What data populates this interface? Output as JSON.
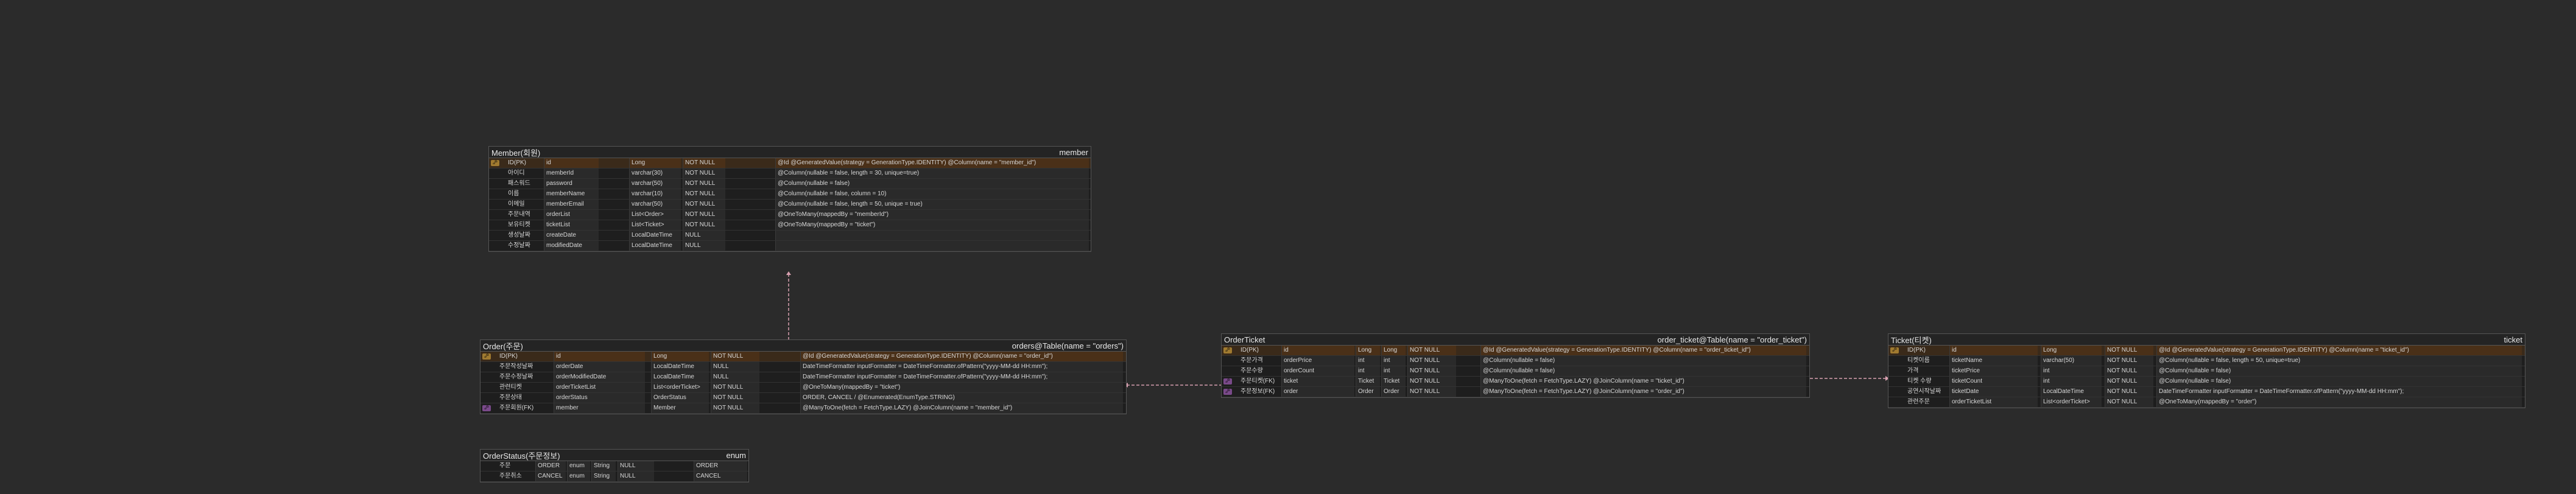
{
  "member": {
    "title": "Member(회원)",
    "table": "member",
    "rows": [
      {
        "badge": "pk",
        "logical": "ID(PK)",
        "physical": "id",
        "type": "Long",
        "null": "NOT NULL",
        "anno": "@Id @GeneratedValue(strategy = GenerationType.IDENTITY) @Column(name = \"member_id\")"
      },
      {
        "badge": "",
        "logical": "아이디",
        "physical": "memberId",
        "type": "varchar(30)",
        "null": "NOT NULL",
        "anno": "@Column(nullable = false, length = 30, unique=true)"
      },
      {
        "badge": "",
        "logical": "패스워드",
        "physical": "password",
        "type": "varchar(50)",
        "null": "NOT NULL",
        "anno": "@Column(nullable = false)"
      },
      {
        "badge": "",
        "logical": "이름",
        "physical": "memberName",
        "type": "varchar(10)",
        "null": "NOT NULL",
        "anno": "@Column(nullable = false, column = 10)"
      },
      {
        "badge": "",
        "logical": "이메일",
        "physical": "memberEmail",
        "type": "varchar(50)",
        "null": "NOT NULL",
        "anno": "@Column(nullable = false, length = 50, unique = true)"
      },
      {
        "badge": "",
        "logical": "주문내역",
        "physical": "orderList",
        "type": "List<Order>",
        "null": "NOT NULL",
        "anno": "@OneToMany(mappedBy = \"memberId\")"
      },
      {
        "badge": "",
        "logical": "보유티켓",
        "physical": "ticketList",
        "type": "List<Ticket>",
        "null": "NOT NULL",
        "anno": "@OneToMany(mappedBy = \"ticket\")"
      },
      {
        "badge": "",
        "logical": "생성날짜",
        "physical": "createDate",
        "type": "LocalDateTime",
        "null": "NULL",
        "anno": ""
      },
      {
        "badge": "",
        "logical": "수정날짜",
        "physical": "modifiedDate",
        "type": "LocalDateTime",
        "null": "NULL",
        "anno": ""
      }
    ]
  },
  "order": {
    "title": "Order(주문)",
    "table": "orders@Table(name = \"orders\")",
    "rows": [
      {
        "badge": "pk",
        "logical": "ID(PK)",
        "physical": "id",
        "type": "Long",
        "null": "NOT NULL",
        "anno": "@Id @GeneratedValue(strategy = GenerationType.IDENTITY) @Column(name = \"order_id\")"
      },
      {
        "badge": "",
        "logical": "주문작성날짜",
        "physical": "orderDate",
        "type": "LocalDateTime",
        "null": "NULL",
        "anno": "DateTimeFormatter inputFormatter = DateTimeFormatter.ofPattern(\"yyyy-MM-dd HH:mm\");"
      },
      {
        "badge": "",
        "logical": "주문수정날짜",
        "physical": "orderModifiedDate",
        "type": "LocalDateTime",
        "null": "NULL",
        "anno": "DateTimeFormatter inputFormatter = DateTimeFormatter.ofPattern(\"yyyy-MM-dd HH:mm\");"
      },
      {
        "badge": "",
        "logical": "관련티켓",
        "physical": "orderTicketList",
        "type": "List<orderTicket>",
        "null": "NOT NULL",
        "anno": "@OneToMany(mappedBy = \"ticket\")"
      },
      {
        "badge": "",
        "logical": "주문상태",
        "physical": "orderStatus",
        "type": "OrderStatus",
        "null": "NOT NULL",
        "anno": "ORDER, CANCEL / @Enumerated(EnumType.STRING)"
      },
      {
        "badge": "fk",
        "logical": "주문회원(FK)",
        "physical": "member",
        "type": "Member",
        "null": "NOT NULL",
        "anno": "@ManyToOne(fetch = FetchType.LAZY) @JoinColumn(name = \"member_id\")"
      }
    ]
  },
  "orderStatus": {
    "title": "OrderStatus(주문정보)",
    "table": "enum",
    "rows": [
      {
        "logical": "주문",
        "physical": "ORDER",
        "type": "enum",
        "jtype": "String",
        "null": "NULL",
        "anno": "ORDER"
      },
      {
        "logical": "주문취소",
        "physical": "CANCEL",
        "type": "enum",
        "jtype": "String",
        "null": "NULL",
        "anno": "CANCEL"
      }
    ]
  },
  "orderTicket": {
    "title": "OrderTicket",
    "table": "order_ticket@Table(name = \"order_ticket\")",
    "rows": [
      {
        "badge": "pk",
        "logical": "ID(PK)",
        "physical": "id",
        "type": "Long",
        "jtype": "Long",
        "null": "NOT NULL",
        "anno": "@Id @GeneratedValue(strategy = GenerationType.IDENTITY) @Column(name = \"order_ticket_id\")"
      },
      {
        "badge": "",
        "logical": "주문가격",
        "physical": "orderPrice",
        "type": "int",
        "jtype": "int",
        "null": "NOT NULL",
        "anno": "@Column(nullable = false)"
      },
      {
        "badge": "",
        "logical": "주문수량",
        "physical": "orderCount",
        "type": "int",
        "jtype": "int",
        "null": "NOT NULL",
        "anno": "@Column(nullable = false)"
      },
      {
        "badge": "fk",
        "logical": "주문티켓(FK)",
        "physical": "ticket",
        "type": "Ticket",
        "jtype": "Ticket",
        "null": "NOT NULL",
        "anno": "@ManyToOne(fetch = FetchType.LAZY) @JoinColumn(name = \"ticket_id\")"
      },
      {
        "badge": "fk",
        "logical": "주문정보(FK)",
        "physical": "order",
        "type": "Order",
        "jtype": "Order",
        "null": "NOT NULL",
        "anno": "@ManyToOne(fetch = FetchType.LAZY) @JoinColumn(name = \"order_id\")"
      }
    ]
  },
  "ticket": {
    "title": "Ticket(티켓)",
    "table": "ticket",
    "rows": [
      {
        "badge": "pk",
        "logical": "ID(PK)",
        "physical": "id",
        "type": "Long",
        "null": "NOT NULL",
        "anno": "@Id @GeneratedValue(strategy = GenerationType.IDENTITY) @Column(name = \"ticket_id\")"
      },
      {
        "badge": "",
        "logical": "티켓이름",
        "physical": "ticketName",
        "type": "varchar(50)",
        "null": "NOT NULL",
        "anno": "@Column(nullable = false, length = 50, unique=true)"
      },
      {
        "badge": "",
        "logical": "가격",
        "physical": "ticketPrice",
        "type": "int",
        "null": "NOT NULL",
        "anno": "@Column(nullable = false)"
      },
      {
        "badge": "",
        "logical": "티켓 수량",
        "physical": "ticketCount",
        "type": "int",
        "null": "NOT NULL",
        "anno": "@Column(nullable = false)"
      },
      {
        "badge": "",
        "logical": "공연시작날짜",
        "physical": "ticketDate",
        "type": "LocalDateTime",
        "null": "NOT NULL",
        "anno": "DateTimeFormatter inputFormatter = DateTimeFormatter.ofPattern(\"yyyy-MM-dd HH:mm\");"
      },
      {
        "badge": "",
        "logical": "관련주문",
        "physical": "orderTicketList",
        "type": "List<orderTicket>",
        "null": "NOT NULL",
        "anno": "@OneToMany(mappedBy = \"order\")"
      }
    ]
  },
  "colors": {
    "background": "#2b2b2b",
    "pk_row": "#3a2a1a",
    "connector": "#d8a0b0"
  }
}
